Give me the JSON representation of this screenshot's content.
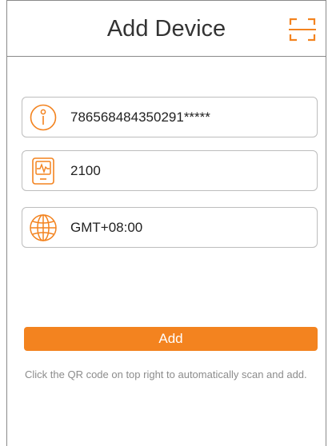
{
  "header": {
    "title": "Add Device",
    "scan_icon": "qr-scan-icon"
  },
  "fields": {
    "device_id": {
      "icon": "info-icon",
      "value": "786568484350291*****"
    },
    "port": {
      "icon": "device-monitor-icon",
      "value": "2100"
    },
    "timezone": {
      "icon": "globe-icon",
      "value": "GMT+08:00"
    }
  },
  "actions": {
    "add_label": "Add"
  },
  "hint": "Click the QR code on top right to automatically scan and add.",
  "colors": {
    "accent": "#f3831f",
    "border": "#bdbdbd",
    "hint": "#8c8c8c"
  }
}
